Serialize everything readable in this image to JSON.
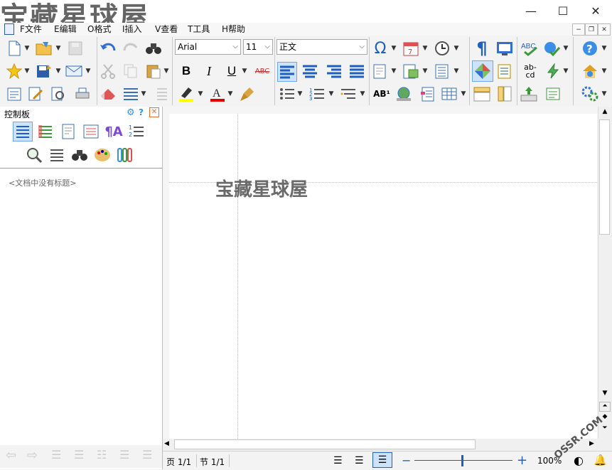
{
  "title_watermark": "宝藏星球屋",
  "window_buttons": {
    "minimize": "—",
    "maximize": "☐",
    "close": "✕"
  },
  "menu": [
    {
      "label": "F文件"
    },
    {
      "label": "E编辑"
    },
    {
      "label": "O格式"
    },
    {
      "label": "I插入"
    },
    {
      "label": "V查看"
    },
    {
      "label": "T工具"
    },
    {
      "label": "H帮助"
    }
  ],
  "mdi_buttons": {
    "minimize": "−",
    "restore": "❐",
    "close": "✕"
  },
  "toolbar": {
    "font_name": "Arial",
    "font_size": "11",
    "style_name": "正文",
    "bold": "B",
    "italic": "I",
    "underline": "U",
    "strike": "ABC",
    "superscript": "AB¹",
    "spell_label_top": "ab-",
    "spell_label_bottom": "cd",
    "abc_label": "ABC"
  },
  "panel": {
    "title": "控制板",
    "help": "?",
    "outline_empty": "<文档中没有标题>"
  },
  "document": {
    "text": "宝藏星球屋"
  },
  "status": {
    "page": "页 1/1",
    "section": "节 1/1",
    "zoom_minus": "−",
    "zoom_plus": "+",
    "zoom_level": "100%",
    "watermark": "OSSR.COM"
  },
  "colors": {
    "accent_blue": "#1e5fbf",
    "highlight_yellow": "#ffff00",
    "font_red": "#e00000",
    "bell_red": "#e02020"
  }
}
